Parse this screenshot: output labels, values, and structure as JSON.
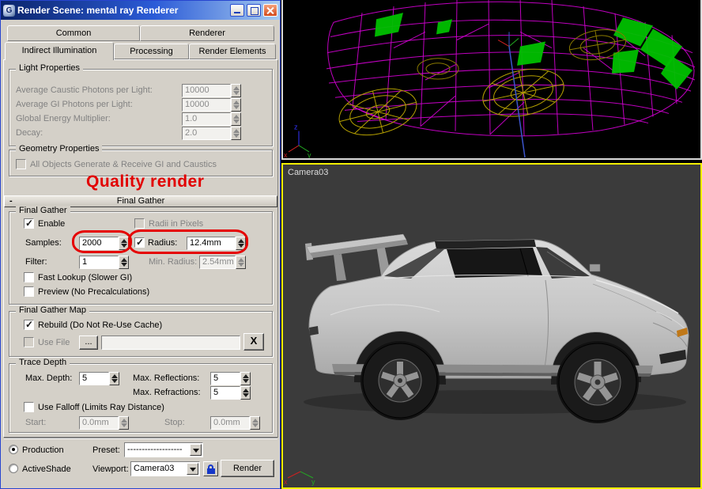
{
  "window": {
    "title": "Render Scene: mental ray Renderer",
    "app_icon_glyph": "G"
  },
  "icons": {
    "minimize": "minimize-icon",
    "maximize": "maximize-icon",
    "close": "close-icon",
    "lock": "lock-icon"
  },
  "tabs": {
    "row1": [
      {
        "label": "Common"
      },
      {
        "label": "Renderer"
      }
    ],
    "row2": [
      {
        "label": "Indirect Illumination",
        "active": true
      },
      {
        "label": "Processing"
      },
      {
        "label": "Render Elements"
      }
    ]
  },
  "light_properties": {
    "title": "Light Properties",
    "avg_caustic_label": "Average Caustic Photons per Light:",
    "avg_caustic_value": "10000",
    "avg_gi_label": "Average GI Photons per Light:",
    "avg_gi_value": "10000",
    "energy_label": "Global Energy Multiplier:",
    "energy_value": "1.0",
    "decay_label": "Decay:",
    "decay_value": "2.0"
  },
  "geometry_properties": {
    "title": "Geometry Properties",
    "all_objects_label": "All Objects Generate & Receive GI and Caustics",
    "all_objects_checked": false
  },
  "annotation": {
    "text": "Quality render",
    "color": "#e20000"
  },
  "final_gather": {
    "rollout_title": "Final Gather",
    "rollout_state": "-",
    "group_title": "Final Gather",
    "enable_label": "Enable",
    "enable_checked": true,
    "radii_label": "Radii in Pixels",
    "radii_checked": false,
    "samples_label": "Samples:",
    "samples_value": "2000",
    "radius_label": "Radius:",
    "radius_checked": true,
    "radius_value": "12.4mm",
    "filter_label": "Filter:",
    "filter_value": "1",
    "min_radius_label": "Min. Radius:",
    "min_radius_value": "2.54mm",
    "fast_lookup_label": "Fast Lookup (Slower GI)",
    "fast_lookup_checked": false,
    "preview_label": "Preview (No Precalculations)",
    "preview_checked": false
  },
  "final_gather_map": {
    "title": "Final Gather Map",
    "rebuild_label": "Rebuild (Do Not Re-Use Cache)",
    "rebuild_checked": true,
    "use_file_label": "Use File",
    "use_file_checked": false,
    "browse_label": "...",
    "file_value": "",
    "clear_label": "X"
  },
  "trace_depth": {
    "title": "Trace Depth",
    "max_depth_label": "Max. Depth:",
    "max_depth_value": "5",
    "max_reflections_label": "Max. Reflections:",
    "max_reflections_value": "5",
    "max_refractions_label": "Max. Refractions:",
    "max_refractions_value": "5",
    "falloff_label": "Use Falloff (Limits Ray Distance)",
    "falloff_checked": false,
    "start_label": "Start:",
    "start_value": "0.0mm",
    "stop_label": "Stop:",
    "stop_value": "0.0mm"
  },
  "footer": {
    "production_label": "Production",
    "production_selected": true,
    "activeshade_label": "ActiveShade",
    "activeshade_selected": false,
    "preset_label": "Preset:",
    "preset_value": "-------------------",
    "viewport_label": "Viewport:",
    "viewport_value": "Camera03",
    "render_label": "Render"
  },
  "viewports": {
    "camera_label": "Camera03",
    "axis": {
      "x": "x",
      "y": "y",
      "z": "z"
    }
  },
  "colors": {
    "dialog_bg": "#d4d0c8",
    "titlebar_left": "#0a246a",
    "titlebar_right": "#a6caf0",
    "annotation_red": "#e20000",
    "active_viewport_border": "#f2ef00",
    "wireframe_magenta": "#d400d4",
    "selection_green": "#00c000",
    "wheel_yellow": "#b5a000"
  }
}
